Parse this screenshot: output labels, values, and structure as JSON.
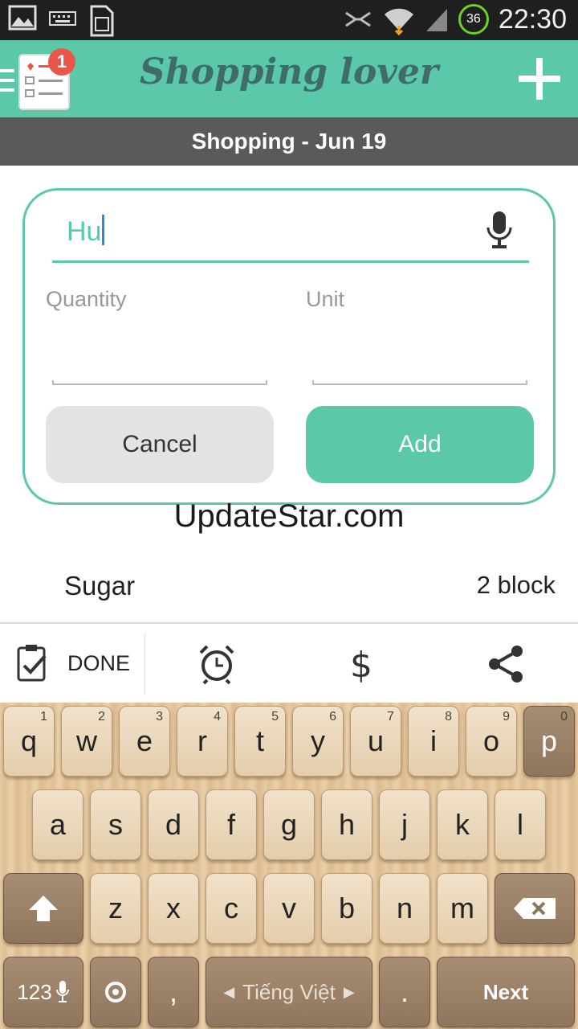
{
  "status_bar": {
    "time": "22:30",
    "battery_level": "36"
  },
  "app_bar": {
    "title": "Shopping lover",
    "badge_count": "1"
  },
  "subheader": {
    "title": "Shopping - Jun 19"
  },
  "dialog": {
    "name_value": "Hu",
    "quantity_label": "Quantity",
    "unit_label": "Unit",
    "cancel_label": "Cancel",
    "add_label": "Add"
  },
  "watermark": "UpdateStar.com",
  "list": [
    {
      "name": "Sugar",
      "quantity": "2 block"
    }
  ],
  "toolbar": {
    "done_label": "DONE"
  },
  "keyboard": {
    "row1": [
      {
        "label": "q",
        "num": "1"
      },
      {
        "label": "w",
        "num": "2"
      },
      {
        "label": "e",
        "num": "3"
      },
      {
        "label": "r",
        "num": "4"
      },
      {
        "label": "t",
        "num": "5"
      },
      {
        "label": "y",
        "num": "6"
      },
      {
        "label": "u",
        "num": "7"
      },
      {
        "label": "i",
        "num": "8"
      },
      {
        "label": "o",
        "num": "9"
      },
      {
        "label": "p",
        "num": "0"
      }
    ],
    "row2": [
      "a",
      "s",
      "d",
      "f",
      "g",
      "h",
      "j",
      "k",
      "l"
    ],
    "row3": [
      "z",
      "x",
      "c",
      "v",
      "b",
      "n",
      "m"
    ],
    "symbols_label": "123",
    "comma": ",",
    "period": ".",
    "language_label": "Tiếng Việt",
    "next_label": "Next"
  },
  "colors": {
    "accent": "#5bc8aa",
    "header_dark": "#5a5a5a",
    "badge": "#e8574a"
  }
}
